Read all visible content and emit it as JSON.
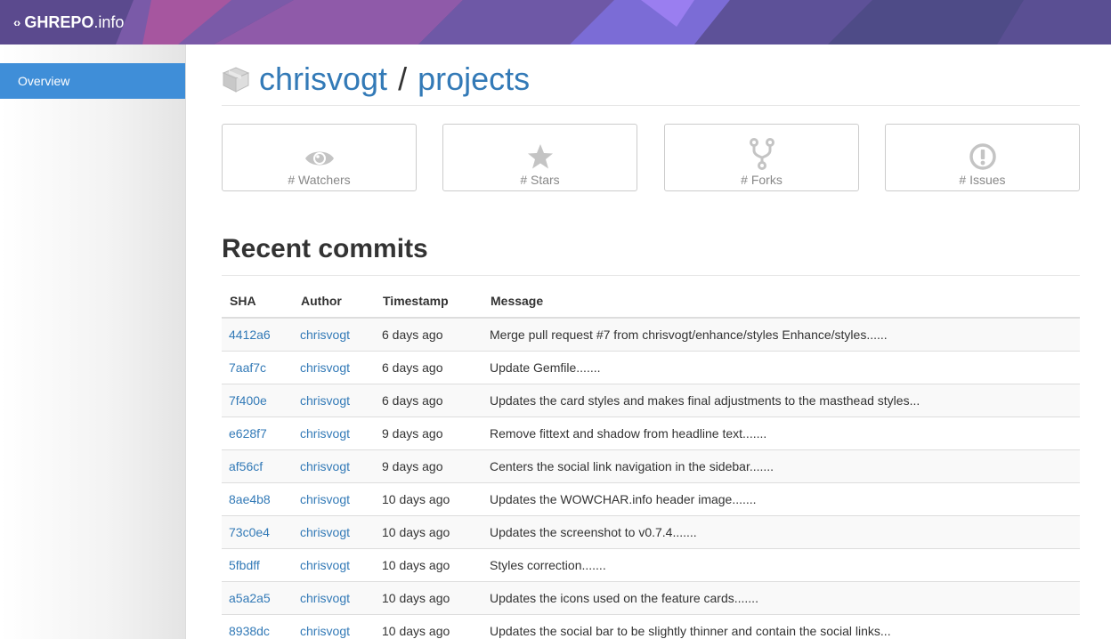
{
  "header": {
    "brand_strong": "GHREPO",
    "brand_light": ".info",
    "colors": {
      "base": "#6a4fa0",
      "accent": "#8a4fb6"
    }
  },
  "sidebar": {
    "items": [
      {
        "label": "Overview",
        "active": true
      }
    ]
  },
  "repo": {
    "owner": "chrisvogt",
    "separator": "/",
    "name": "projects"
  },
  "stats": [
    {
      "icon": "eye-icon",
      "label": "# Watchers"
    },
    {
      "icon": "star-icon",
      "label": "# Stars"
    },
    {
      "icon": "fork-icon",
      "label": "# Forks"
    },
    {
      "icon": "exclamation-circle-icon",
      "label": "# Issues"
    }
  ],
  "commits": {
    "title": "Recent commits",
    "columns": [
      "SHA",
      "Author",
      "Timestamp",
      "Message"
    ],
    "rows": [
      {
        "sha": "4412a6",
        "author": "chrisvogt",
        "time": "6 days ago",
        "message": "Merge pull request #7 from chrisvogt/enhance/styles Enhance/styles......"
      },
      {
        "sha": "7aaf7c",
        "author": "chrisvogt",
        "time": "6 days ago",
        "message": "Update Gemfile......."
      },
      {
        "sha": "7f400e",
        "author": "chrisvogt",
        "time": "6 days ago",
        "message": "Updates the card styles and makes final adjustments to the masthead styles..."
      },
      {
        "sha": "e628f7",
        "author": "chrisvogt",
        "time": "9 days ago",
        "message": "Remove fittext and shadow from headline text......."
      },
      {
        "sha": "af56cf",
        "author": "chrisvogt",
        "time": "9 days ago",
        "message": "Centers the social link navigation in the sidebar......."
      },
      {
        "sha": "8ae4b8",
        "author": "chrisvogt",
        "time": "10 days ago",
        "message": "Updates the WOWCHAR.info header image......."
      },
      {
        "sha": "73c0e4",
        "author": "chrisvogt",
        "time": "10 days ago",
        "message": "Updates the screenshot to v0.7.4......."
      },
      {
        "sha": "5fbdff",
        "author": "chrisvogt",
        "time": "10 days ago",
        "message": "Styles correction......."
      },
      {
        "sha": "a5a2a5",
        "author": "chrisvogt",
        "time": "10 days ago",
        "message": "Updates the icons used on the feature cards......."
      },
      {
        "sha": "8938dc",
        "author": "chrisvogt",
        "time": "10 days ago",
        "message": "Updates the social bar to be slightly thinner and contain the social links..."
      }
    ]
  }
}
